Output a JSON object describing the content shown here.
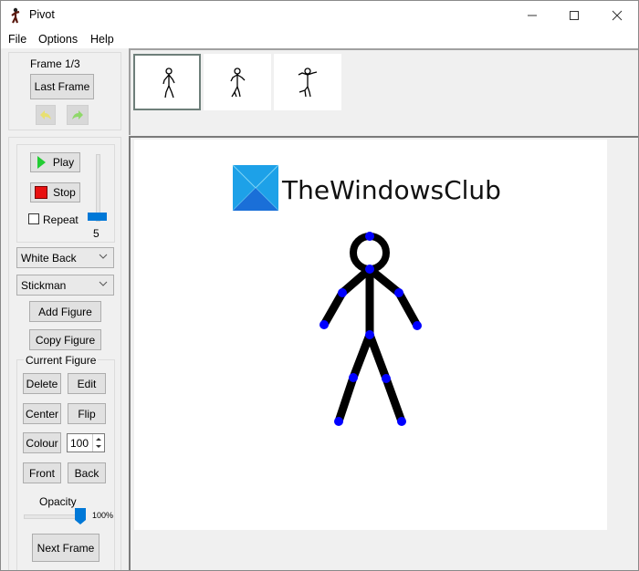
{
  "window": {
    "title": "Pivot",
    "controls": {
      "minimize": "minimize-icon",
      "maximize": "maximize-icon",
      "close": "close-icon"
    }
  },
  "menu": [
    "File",
    "Options",
    "Help"
  ],
  "frame_panel": {
    "frame_label": "Frame 1/3",
    "last_frame_label": "Last Frame",
    "undo_icon": "undo-arrow-icon",
    "redo_icon": "redo-arrow-icon"
  },
  "playback": {
    "play_label": "Play",
    "stop_label": "Stop",
    "repeat_label": "Repeat",
    "repeat_checked": false,
    "speed_value": "5"
  },
  "background_select": {
    "value": "White Back"
  },
  "figure_type_select": {
    "value": "Stickman"
  },
  "figure_buttons": {
    "add": "Add Figure",
    "copy": "Copy Figure"
  },
  "current_figure": {
    "title": "Current Figure",
    "delete": "Delete",
    "edit": "Edit",
    "center": "Center",
    "flip": "Flip",
    "colour": "Colour",
    "size_value": "100",
    "front": "Front",
    "back": "Back",
    "opacity_label": "Opacity",
    "opacity_value": "100%",
    "opacity_fraction": 1.0
  },
  "next_frame_label": "Next Frame",
  "thumbnails": [
    {
      "name": "frame-1",
      "selected": true
    },
    {
      "name": "frame-2",
      "selected": false
    },
    {
      "name": "frame-3",
      "selected": false
    }
  ],
  "canvas": {
    "watermark_text": "TheWindowsClub",
    "joint_color": "#0000ff",
    "stick_color": "#000000"
  }
}
